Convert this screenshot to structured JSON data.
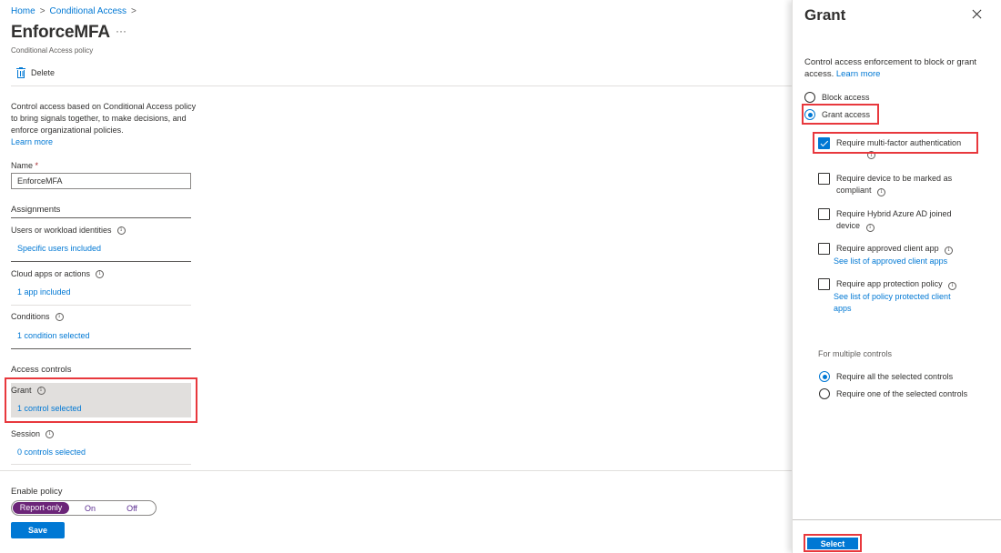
{
  "breadcrumb": [
    {
      "label": "Home"
    },
    {
      "label": "Conditional Access"
    }
  ],
  "breadcrumb_separator": ">",
  "page": {
    "title": "EnforceMFA",
    "more_label": "···",
    "subtitle": "Conditional Access policy"
  },
  "toolbar": {
    "delete_label": "Delete"
  },
  "description": {
    "text": "Control access based on Conditional Access policy to bring signals together, to make decisions, and enforce organizational policies.",
    "learn_more": "Learn more"
  },
  "name_field": {
    "label": "Name",
    "required_mark": "*",
    "value": "EnforceMFA"
  },
  "assignments": {
    "heading": "Assignments",
    "items": [
      {
        "label": "Users or workload identities",
        "value": "Specific users included"
      },
      {
        "label": "Cloud apps or actions",
        "value": "1 app included"
      },
      {
        "label": "Conditions",
        "value": "1 condition selected"
      }
    ]
  },
  "access_controls": {
    "heading": "Access controls",
    "items": [
      {
        "label": "Grant",
        "value": "1 control selected",
        "highlighted": true
      },
      {
        "label": "Session",
        "value": "0 controls selected"
      }
    ]
  },
  "enable_policy": {
    "label": "Enable policy",
    "options": [
      "Report-only",
      "On",
      "Off"
    ],
    "selected": "Report-only"
  },
  "save_label": "Save",
  "info_glyph": "i",
  "blade": {
    "title": "Grant",
    "description": "Control access enforcement to block or grant access.",
    "learn_more": "Learn more",
    "access_options": [
      {
        "label": "Block access",
        "selected": false
      },
      {
        "label": "Grant access",
        "selected": true
      }
    ],
    "controls": [
      {
        "label": "Require multi-factor authentication",
        "checked": true,
        "link": null
      },
      {
        "label": "Require device to be marked as compliant",
        "checked": false,
        "link": null
      },
      {
        "label": "Require Hybrid Azure AD joined device",
        "checked": false,
        "link": null
      },
      {
        "label": "Require approved client app",
        "checked": false,
        "link": "See list of approved client apps"
      },
      {
        "label": "Require app protection policy",
        "checked": false,
        "link": "See list of policy protected client apps"
      }
    ],
    "multiple_controls": {
      "label": "For multiple controls",
      "options": [
        {
          "label": "Require all the selected controls",
          "selected": true
        },
        {
          "label": "Require one of the selected controls",
          "selected": false
        }
      ]
    },
    "select_label": "Select"
  },
  "colors": {
    "accent": "#0078d4",
    "highlight": "#e8383d",
    "toggle_selected": "#6b2478"
  }
}
